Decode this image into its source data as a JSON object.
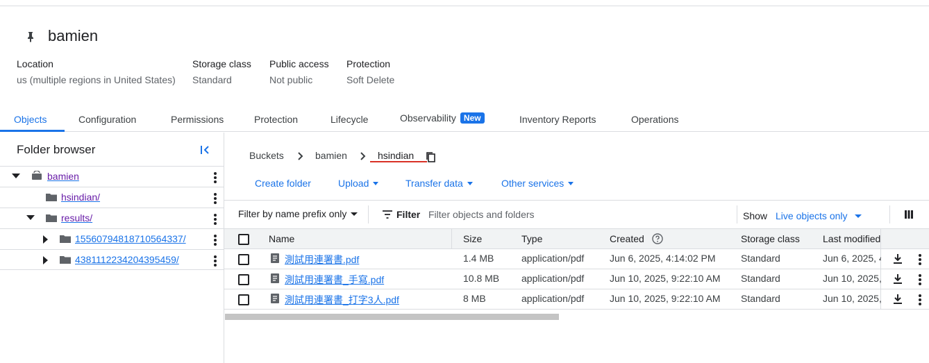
{
  "bucket": {
    "name": "bamien",
    "meta": [
      {
        "label": "Location",
        "value": "us (multiple regions in United States)"
      },
      {
        "label": "Storage class",
        "value": "Standard"
      },
      {
        "label": "Public access",
        "value": "Not public"
      },
      {
        "label": "Protection",
        "value": "Soft Delete"
      }
    ]
  },
  "tabs": [
    {
      "label": "Objects",
      "active": true
    },
    {
      "label": "Configuration"
    },
    {
      "label": "Permissions"
    },
    {
      "label": "Protection"
    },
    {
      "label": "Lifecycle"
    },
    {
      "label": "Observability",
      "badge": "New"
    },
    {
      "label": "Inventory Reports"
    },
    {
      "label": "Operations"
    }
  ],
  "folder_browser": {
    "title": "Folder browser",
    "items": [
      {
        "label": "bamien",
        "icon": "bucket-icon",
        "expanded": true
      },
      {
        "label": "hsindian/",
        "icon": "folder-icon"
      },
      {
        "label": "results/",
        "icon": "folder-icon",
        "expanded": true
      },
      {
        "label": "15560794818710564337/",
        "icon": "folder-icon",
        "expanded": false
      },
      {
        "label": "4381112234204395459/",
        "icon": "folder-icon",
        "expanded": false
      }
    ]
  },
  "breadcrumb": [
    "Buckets",
    "bamien",
    "hsindian"
  ],
  "actions": {
    "create_folder": "Create folder",
    "upload": "Upload",
    "transfer": "Transfer data",
    "other": "Other services"
  },
  "filter": {
    "prefix_label": "Filter by name prefix only",
    "filter_label": "Filter",
    "placeholder": "Filter objects and folders",
    "show_label": "Show",
    "show_value": "Live objects only"
  },
  "table": {
    "headers": [
      "Name",
      "Size",
      "Type",
      "Created",
      "Storage class",
      "Last modified"
    ],
    "rows": [
      {
        "name": "測試用連署書.pdf",
        "size": "1.4 MB",
        "type": "application/pdf",
        "created": "Jun 6, 2025, 4:14:02 PM",
        "storage": "Standard",
        "modified": "Jun 6, 2025, 4"
      },
      {
        "name": "測試用連署書_手寫.pdf",
        "size": "10.8 MB",
        "type": "application/pdf",
        "created": "Jun 10, 2025, 9:22:10 AM",
        "storage": "Standard",
        "modified": "Jun 10, 2025,"
      },
      {
        "name": "測試用連署書_打字3人.pdf",
        "size": "8 MB",
        "type": "application/pdf",
        "created": "Jun 10, 2025, 9:22:10 AM",
        "storage": "Standard",
        "modified": "Jun 10, 2025,"
      }
    ]
  },
  "colors": {
    "accent": "#1a73e8",
    "visited": "#681da8",
    "breadcrumb_underline": "#d93025"
  }
}
